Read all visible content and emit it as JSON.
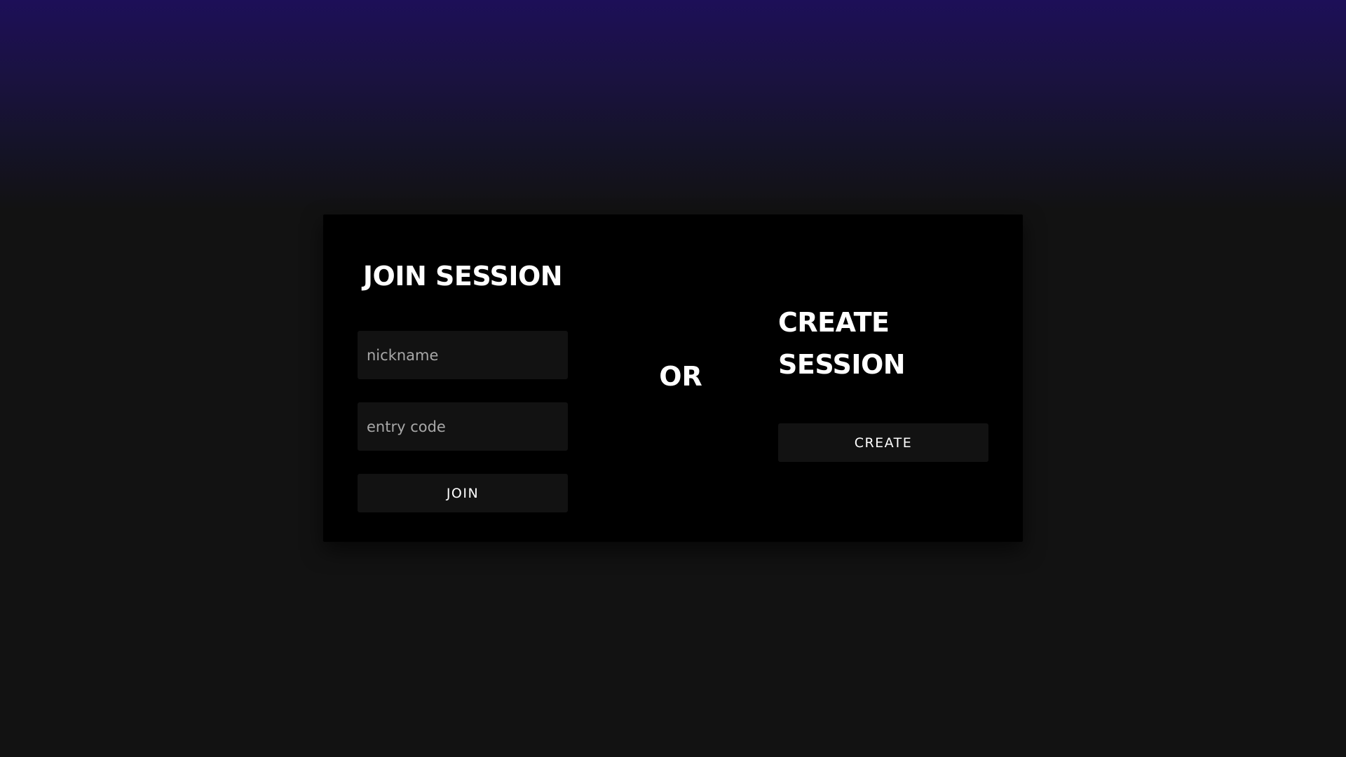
{
  "join": {
    "heading": "JOIN SESSION",
    "nickname_placeholder": "nickname",
    "code_placeholder": "entry code",
    "button_label": "JOIN"
  },
  "separator": {
    "label": "OR"
  },
  "create": {
    "heading": "CREATE SESSION",
    "button_label": "CREATE"
  },
  "colors": {
    "background": "#121212",
    "top_gradient": "#1d0f58",
    "card": "#000000",
    "field": "#121212",
    "text": "#ffffff",
    "placeholder": "#a8a8a8"
  }
}
